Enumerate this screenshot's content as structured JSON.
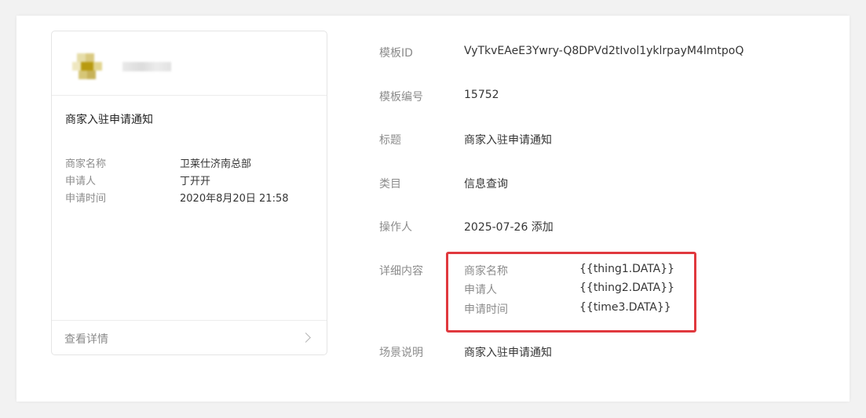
{
  "preview_card": {
    "title": "商家入驻申请通知",
    "fields": [
      {
        "label": "商家名称",
        "value": "卫莱仕济南总部"
      },
      {
        "label": "申请人",
        "value": "丁开开"
      },
      {
        "label": "申请时间",
        "value": "2020年8月20日 21:58"
      }
    ],
    "footer_link": "查看详情"
  },
  "template_info": {
    "template_id_label": "模板ID",
    "template_id": "VyTkvEAeE3Ywry-Q8DPVd2tIvol1yklrpayM4lmtpoQ",
    "template_no_label": "模板编号",
    "template_no": "15752",
    "title_label": "标题",
    "title": "商家入驻申请通知",
    "category_label": "类目",
    "category": "信息查询",
    "operator_label": "操作人",
    "operator": "2025-07-26 添加",
    "detail_label": "详细内容",
    "details": [
      {
        "key": "商家名称",
        "value": "{{thing1.DATA}}"
      },
      {
        "key": "申请人",
        "value": "{{thing2.DATA}}"
      },
      {
        "key": "申请时间",
        "value": "{{time3.DATA}}"
      }
    ],
    "scene_label": "场景说明",
    "scene": "商家入驻申请通知"
  },
  "colors": {
    "highlight_border": "#e0393e",
    "label_gray": "#8c8c8c",
    "text_dark": "#353535"
  }
}
